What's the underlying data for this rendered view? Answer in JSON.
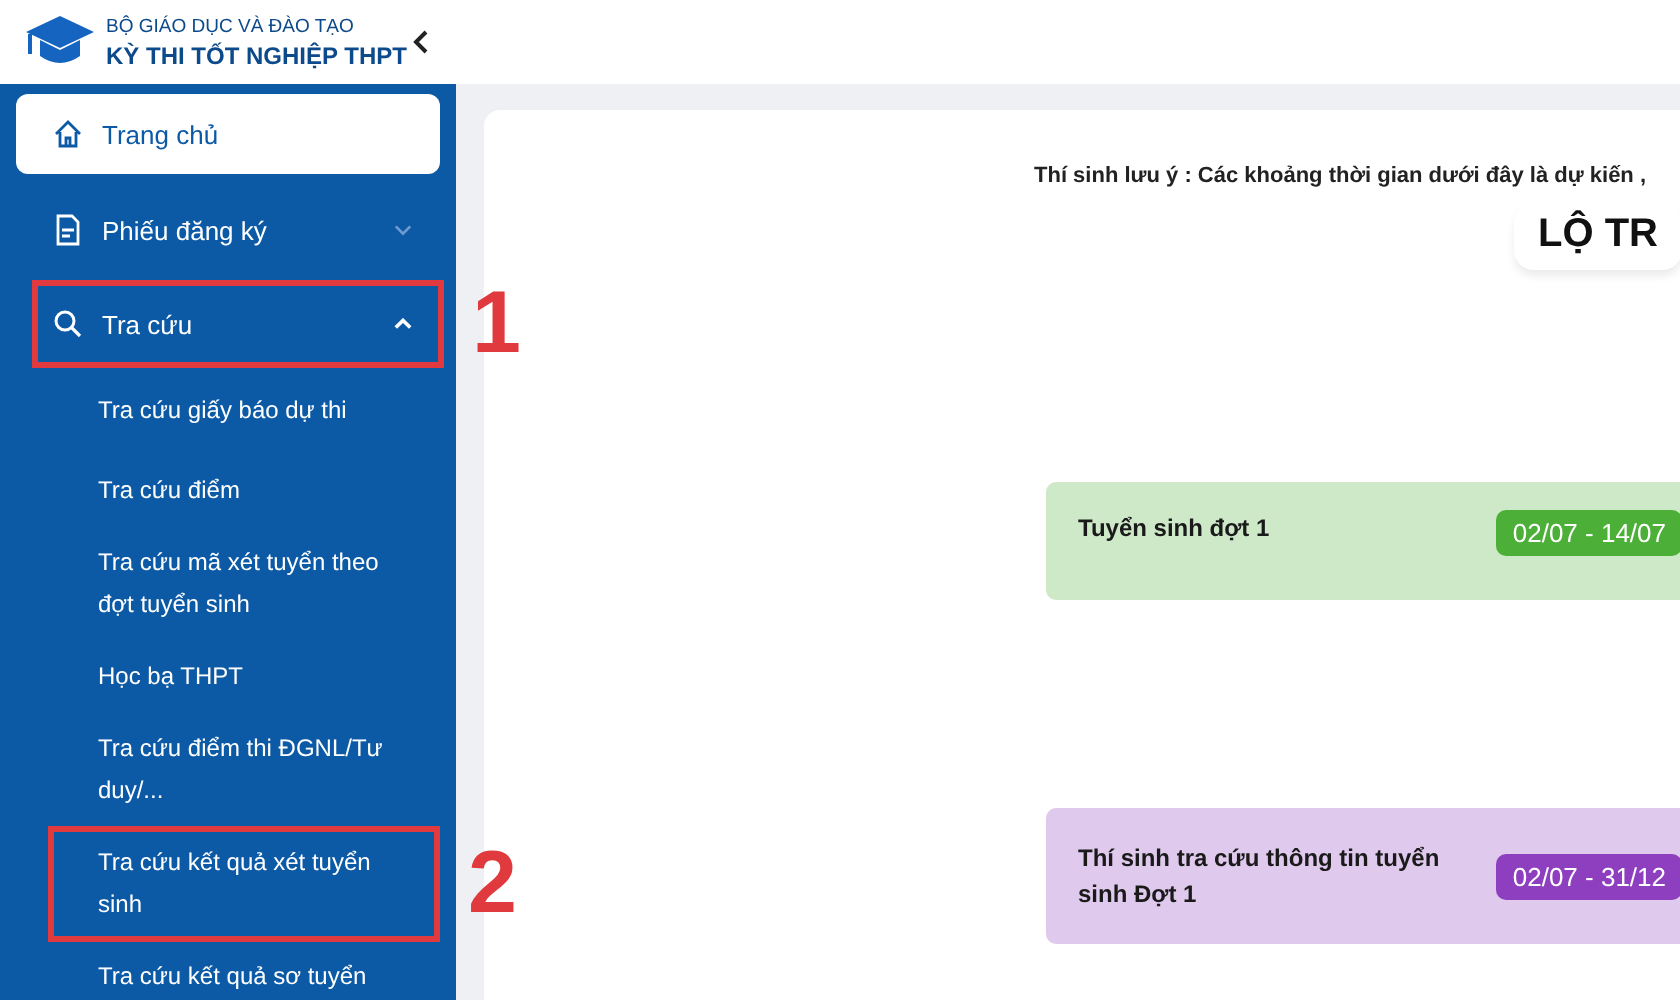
{
  "header": {
    "org": "BỘ GIÁO DỤC VÀ ĐÀO TẠO",
    "title": "KỲ THI TỐT NGHIỆP THPT"
  },
  "sidebar": {
    "items": [
      {
        "label": "Trang chủ",
        "kind": "home",
        "selected": true
      },
      {
        "label": "Phiếu đăng ký",
        "kind": "form",
        "selected": false,
        "expanded": false
      },
      {
        "label": "Tra cứu",
        "kind": "search",
        "selected": false,
        "expanded": true,
        "annotation": "1",
        "children": [
          {
            "label": "Tra cứu giấy báo dự thi"
          },
          {
            "label": "Tra cứu điểm"
          },
          {
            "label": "Tra cứu mã xét tuyển theo đợt tuyển sinh"
          },
          {
            "label": "Học bạ THPT"
          },
          {
            "label": "Tra cứu điểm thi ĐGNL/Tư duy/..."
          },
          {
            "label": "Tra cứu kết quả xét tuyển sinh",
            "annotation": "2"
          },
          {
            "label": "Tra cứu kết quả sơ tuyển"
          }
        ]
      }
    ]
  },
  "main": {
    "note": "Thí sinh lưu ý : Các khoảng thời gian dưới đây là dự kiến ,",
    "title": "LỘ TR",
    "timeline": [
      {
        "label": "Tuyển sinh đợt 1",
        "dates": "02/07 - 14/07",
        "color": "#4caf37"
      },
      {
        "label": "Thí sinh tra cứu thông tin tuyển sinh Đợt 1",
        "dates": "02/07 - 31/12",
        "color": "#8e3fbf"
      }
    ]
  }
}
